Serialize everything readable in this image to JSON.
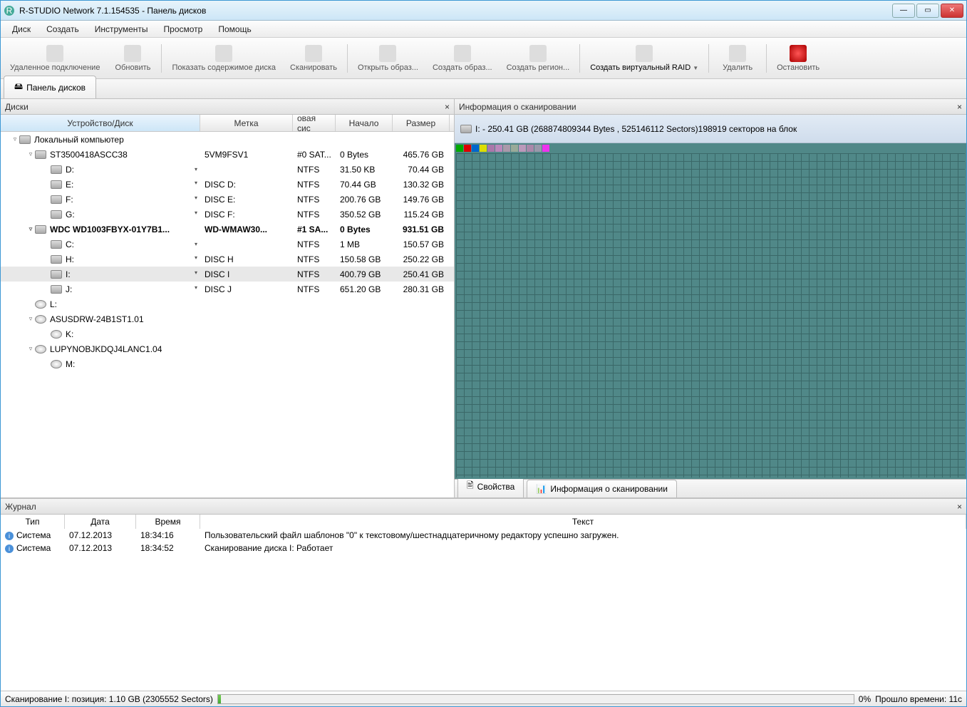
{
  "window": {
    "title": "R-STUDIO Network 7.1.154535 - Панель дисков"
  },
  "menu": [
    "Диск",
    "Создать",
    "Инструменты",
    "Просмотр",
    "Помощь"
  ],
  "toolbar": [
    {
      "label": "Удаленное подключение",
      "name": "remote-connect"
    },
    {
      "label": "Обновить",
      "name": "refresh"
    },
    {
      "label": "Показать содержимое диска",
      "name": "show-contents"
    },
    {
      "label": "Сканировать",
      "name": "scan"
    },
    {
      "label": "Открыть образ...",
      "name": "open-image"
    },
    {
      "label": "Создать образ...",
      "name": "create-image"
    },
    {
      "label": "Создать регион...",
      "name": "create-region"
    },
    {
      "label": "Создать виртуальный RAID",
      "name": "create-raid",
      "active": true,
      "dropdown": true
    },
    {
      "label": "Удалить",
      "name": "delete"
    },
    {
      "label": "Остановить",
      "name": "stop",
      "red": true
    }
  ],
  "tab_label": "Панель дисков",
  "left": {
    "title": "Диски",
    "cols": [
      "Устройство/Диск",
      "Метка",
      "овая сис",
      "Начало",
      "Размер"
    ],
    "rows": [
      {
        "indent": 0,
        "exp": "▿",
        "icon": "pc",
        "text": "Локальный компьютер"
      },
      {
        "indent": 1,
        "exp": "▿",
        "icon": "hdd",
        "text": "ST3500418ASCC38",
        "label": "5VM9FSV1",
        "fs": "#0 SAT...",
        "start": "0 Bytes",
        "size": "465.76 GB"
      },
      {
        "indent": 2,
        "icon": "vol",
        "text": "D:",
        "dd": true,
        "fs": "NTFS",
        "start": "31.50 KB",
        "size": "70.44 GB"
      },
      {
        "indent": 2,
        "icon": "vol",
        "text": "E:",
        "dd": true,
        "label": "DISC D:",
        "fs": "NTFS",
        "start": "70.44 GB",
        "size": "130.32 GB"
      },
      {
        "indent": 2,
        "icon": "vol",
        "text": "F:",
        "dd": true,
        "label": "DISC E:",
        "fs": "NTFS",
        "start": "200.76 GB",
        "size": "149.76 GB"
      },
      {
        "indent": 2,
        "icon": "vol",
        "text": "G:",
        "dd": true,
        "label": "DISC F:",
        "fs": "NTFS",
        "start": "350.52 GB",
        "size": "115.24 GB"
      },
      {
        "indent": 1,
        "exp": "▿",
        "icon": "hdd",
        "text": "WDC WD1003FBYX-01Y7B1...",
        "label": "WD-WMAW30...",
        "fs": "#1 SA...",
        "start": "0 Bytes",
        "size": "931.51 GB",
        "bold": true
      },
      {
        "indent": 2,
        "icon": "vol",
        "text": "C:",
        "dd": true,
        "fs": "NTFS",
        "start": "1 MB",
        "size": "150.57 GB"
      },
      {
        "indent": 2,
        "icon": "vol",
        "text": "H:",
        "dd": true,
        "label": "DISC H",
        "fs": "NTFS",
        "start": "150.58 GB",
        "size": "250.22 GB"
      },
      {
        "indent": 2,
        "icon": "vol",
        "text": "I:",
        "dd": true,
        "label": "DISC I",
        "fs": "NTFS",
        "start": "400.79 GB",
        "size": "250.41 GB",
        "sel": true
      },
      {
        "indent": 2,
        "icon": "vol",
        "text": "J:",
        "dd": true,
        "label": "DISC J",
        "fs": "NTFS",
        "start": "651.20 GB",
        "size": "280.31 GB"
      },
      {
        "indent": 1,
        "icon": "cd",
        "text": "L:"
      },
      {
        "indent": 1,
        "exp": "▿",
        "icon": "cd",
        "text": "ASUSDRW-24B1ST1.01"
      },
      {
        "indent": 2,
        "icon": "cd",
        "text": "K:"
      },
      {
        "indent": 1,
        "exp": "▿",
        "icon": "cd",
        "text": "LUPYNOBJKDQJ4LANC1.04"
      },
      {
        "indent": 2,
        "icon": "cd",
        "text": "M:"
      }
    ]
  },
  "right": {
    "title": "Информация о сканировании",
    "info": "I: - 250.41 GB (268874809344 Bytes , 525146112 Sectors)198919 секторов на блок",
    "tabs": [
      "Свойства",
      "Информация о сканировании"
    ]
  },
  "log": {
    "title": "Журнал",
    "cols": [
      "Тип",
      "Дата",
      "Время",
      "Текст"
    ],
    "rows": [
      {
        "type": "Система",
        "date": "07.12.2013",
        "time": "18:34:16",
        "text": "Пользовательский файл шаблонов \"0\" к текстовому/шестнадцатеричному редактору успешно загружен."
      },
      {
        "type": "Система",
        "date": "07.12.2013",
        "time": "18:34:52",
        "text": "Сканирование диска I: Работает"
      }
    ]
  },
  "status": {
    "text": "Сканирование I: позиция: 1.10 GB (2305552 Sectors)",
    "pct": "0%",
    "elapsed": "Прошло времени: 11с"
  }
}
